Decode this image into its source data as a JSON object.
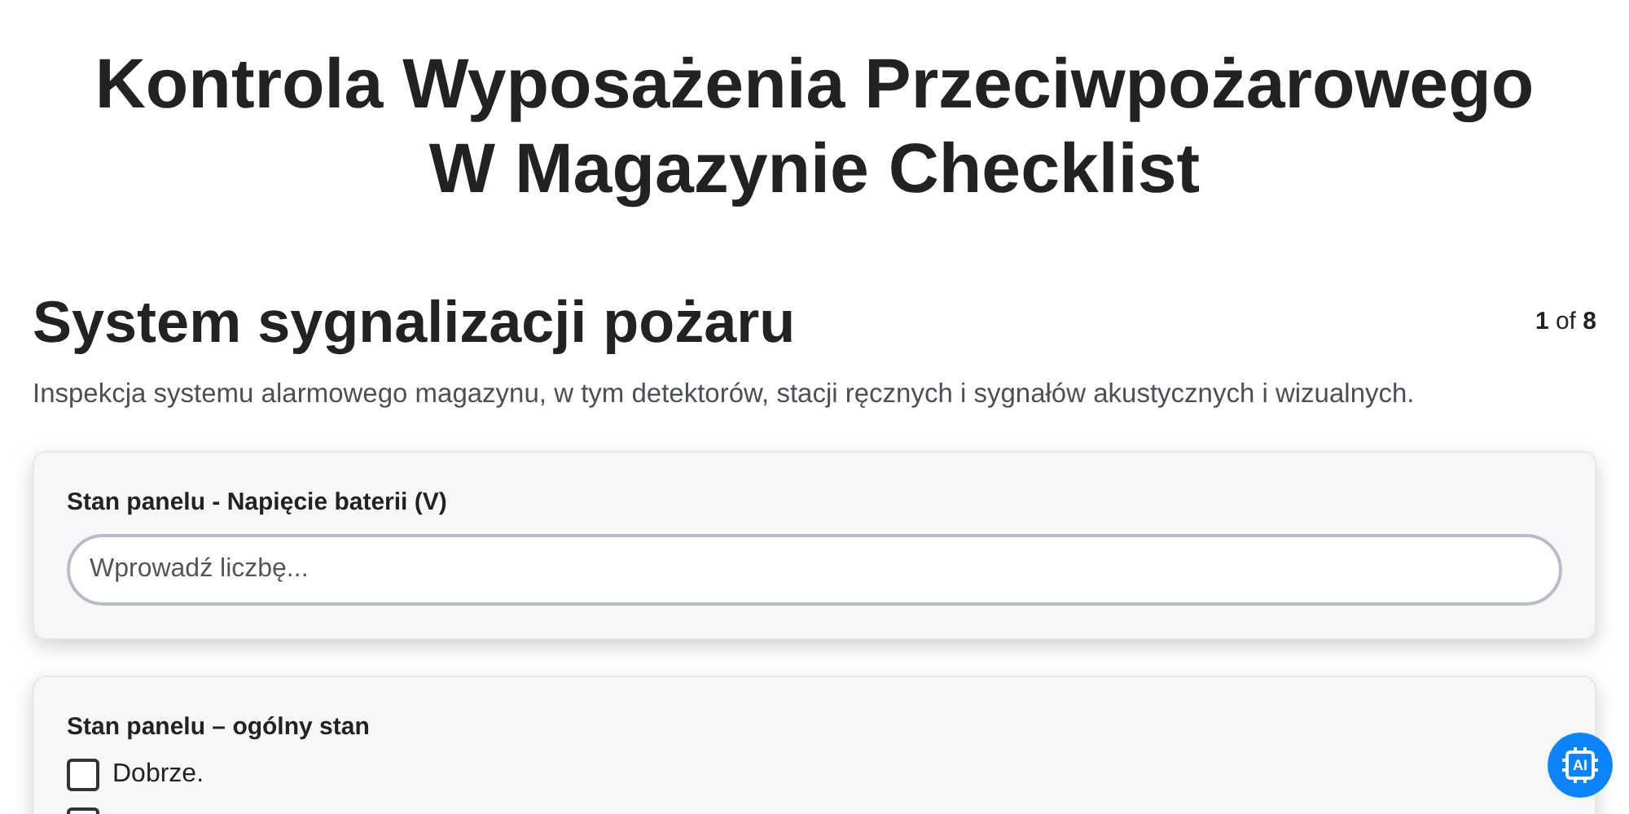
{
  "title": "Kontrola Wyposażenia Przeciwpożarowego W Magazynie Checklist",
  "section": {
    "heading": "System sygnalizacji pożaru",
    "page_current": "1",
    "page_of": "of",
    "page_total": "8",
    "description": "Inspekcja systemu alarmowego magazynu, w tym detektorów, stacji ręcznych i sygnałów akustycznych i wizualnych."
  },
  "questions": [
    {
      "kind": "number",
      "label": "Stan panelu - Napięcie baterii (V)",
      "placeholder": "Wprowadź liczbę..."
    },
    {
      "kind": "checklist",
      "label": "Stan panelu – ogólny stan",
      "options": [
        {
          "label": "Dobrze.",
          "checked": false
        },
        {
          "checked": false
        }
      ]
    }
  ],
  "assistant_button": {
    "label": "AI"
  }
}
